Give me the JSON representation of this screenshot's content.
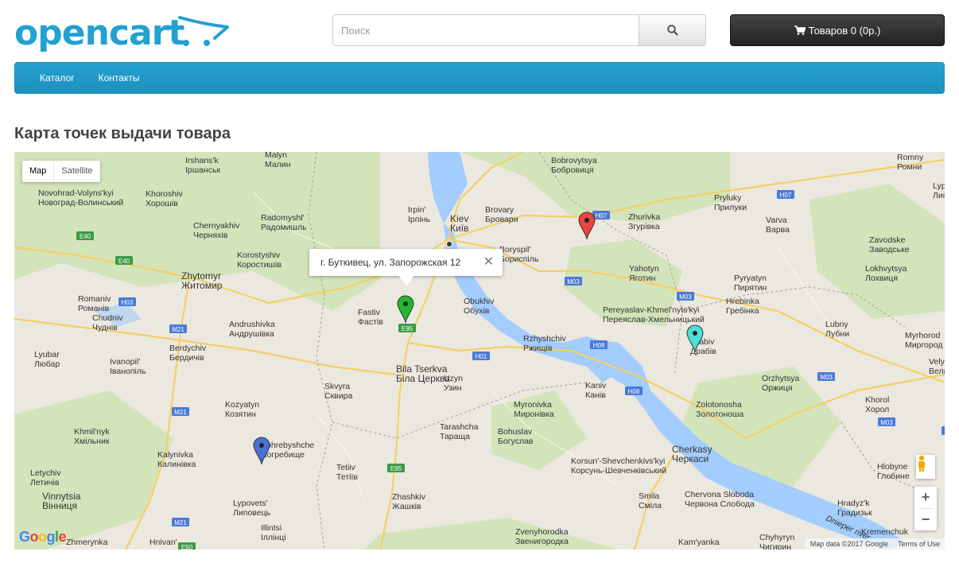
{
  "header": {
    "logo_text": "opencart",
    "search_placeholder": "Поиск",
    "cart_label": "Товаров 0 (0р.)"
  },
  "menu": {
    "items": [
      {
        "label": "Каталог"
      },
      {
        "label": "Контакты"
      }
    ]
  },
  "page": {
    "title": "Карта точек выдачи товара"
  },
  "map": {
    "type_buttons": [
      {
        "label": "Map"
      },
      {
        "label": "Satellite"
      }
    ],
    "infowindow_text": "г. Буткивец, ул. Запорожская 12",
    "brand": "Google",
    "attribution": [
      "Map data ©2017 Google",
      "Terms of Use"
    ],
    "markers": [
      {
        "color": "#e8453c"
      },
      {
        "color": "#1fb830"
      },
      {
        "color": "#4be0d6"
      },
      {
        "color": "#4b71d7"
      }
    ],
    "cities": [
      {
        "name": "Malyn",
        "local": "Малин"
      },
      {
        "name": "Irshans'k",
        "local": "Іршанськ"
      },
      {
        "name": "Bobrovytsya",
        "local": "Бобровиця"
      },
      {
        "name": "Romny",
        "local": "Ромни"
      },
      {
        "name": "Novohrad-Volyns'kyi",
        "local": "Новоград-Волинський"
      },
      {
        "name": "Khoroshiv",
        "local": "Хорошів"
      },
      {
        "name": "Radomyshl'",
        "local": "Радомишль"
      },
      {
        "name": "Irpin'",
        "local": "Ірпінь"
      },
      {
        "name": "Kiev",
        "local": "Київ"
      },
      {
        "name": "Brovary",
        "local": "Бровари"
      },
      {
        "name": "Zhurivka",
        "local": "Згурівка"
      },
      {
        "name": "Pryluky",
        "local": "Прилуки"
      },
      {
        "name": "Lypova Dolyna",
        "local": "Липова Долина"
      },
      {
        "name": "Chernyakhiv",
        "local": "Черняхів"
      },
      {
        "name": "Varva",
        "local": "Варва"
      },
      {
        "name": "Boryspil'",
        "local": "Бориспіль"
      },
      {
        "name": "Zavodske",
        "local": "Заводське"
      },
      {
        "name": "Korostyshiv",
        "local": "Коростишів"
      },
      {
        "name": "Zhytomyr",
        "local": "Житомир"
      },
      {
        "name": "Yahotyn",
        "local": "Яготин"
      },
      {
        "name": "Pyryatyn",
        "local": "Пирятин"
      },
      {
        "name": "Lokhvytsya",
        "local": "Лохвиця"
      },
      {
        "name": "Romaniv",
        "local": "Романів"
      },
      {
        "name": "Fastiv",
        "local": "Фастів"
      },
      {
        "name": "Obukhiv",
        "local": "Обухів"
      },
      {
        "name": "Pereyaslav-Khmel'nyts'kyi",
        "local": "Переяслав-Хмельницький"
      },
      {
        "name": "Hrebinka",
        "local": "Гребінка"
      },
      {
        "name": "Lubny",
        "local": "Лубни"
      },
      {
        "name": "Chudniv",
        "local": "Чуднів"
      },
      {
        "name": "Andrushivka",
        "local": "Андрушівка"
      },
      {
        "name": "Rzhyshchiv",
        "local": "Ржищів"
      },
      {
        "name": "Drabiv",
        "local": "Драбів"
      },
      {
        "name": "Myrhorod",
        "local": "Миргород"
      },
      {
        "name": "Berdychiv",
        "local": "Бердичів"
      },
      {
        "name": "Lyubar",
        "local": "Любар"
      },
      {
        "name": "Ivanopil'",
        "local": "Іванопіль"
      },
      {
        "name": "Bila Tserkva",
        "local": "Біла Церква"
      },
      {
        "name": "Uzyn",
        "local": "Узин"
      },
      {
        "name": "Kaniv",
        "local": "Канів"
      },
      {
        "name": "Orzhytsya",
        "local": "Оржиця"
      },
      {
        "name": "Velyka Bahachka",
        "local": "Велика Багачка"
      },
      {
        "name": "Skvyra",
        "local": "Сквира"
      },
      {
        "name": "Myronivka",
        "local": "Миронівка"
      },
      {
        "name": "Zolotonosha",
        "local": "Золотоноша"
      },
      {
        "name": "Khorol",
        "local": "Хорол"
      },
      {
        "name": "Kozyatyn",
        "local": "Козятин"
      },
      {
        "name": "Khmil'nyk",
        "local": "Хмільник"
      },
      {
        "name": "Tarashcha",
        "local": "Тараща"
      },
      {
        "name": "Bohuslav",
        "local": "Богуслав"
      },
      {
        "name": "Pohrebyshche",
        "local": "Погребище"
      },
      {
        "name": "Kalynivka",
        "local": "Калинівка"
      },
      {
        "name": "Korsun'-Shevchenkivs'kyi",
        "local": "Корсунь-Шевченківський"
      },
      {
        "name": "Cherkasy",
        "local": "Черкаси"
      },
      {
        "name": "Letychiv",
        "local": "Летичів"
      },
      {
        "name": "Tetiiv",
        "local": "Тетіїв"
      },
      {
        "name": "Hlobyne",
        "local": "Глобине"
      },
      {
        "name": "Vinnytsia",
        "local": "Вінниця"
      },
      {
        "name": "Lypovets'",
        "local": "Липовець"
      },
      {
        "name": "Zhashkiv",
        "local": "Жашків"
      },
      {
        "name": "Smila",
        "local": "Сміла"
      },
      {
        "name": "Chervona Sloboda",
        "local": "Червона Слобода"
      },
      {
        "name": "Hradyz'k",
        "local": "Градизьк"
      },
      {
        "name": "Illintsi",
        "local": "Іллінці"
      },
      {
        "name": "Zvenyhorodka",
        "local": "Звенигородка"
      },
      {
        "name": "Kremenchuk",
        "local": ""
      },
      {
        "name": "Zhmerynka",
        "local": ""
      },
      {
        "name": "Hnivan'",
        "local": ""
      },
      {
        "name": "Kam'yanka",
        "local": ""
      },
      {
        "name": "Chyhyryn",
        "local": "Чигирин"
      },
      {
        "name": "Dnieper river",
        "local": ""
      }
    ],
    "shields": [
      "E40",
      "E40",
      "H03",
      "M21",
      "E95",
      "H07",
      "H07",
      "M03",
      "M03",
      "H08",
      "H08",
      "H01",
      "M21",
      "E95",
      "M21",
      "E50",
      "M03",
      "M03",
      "H03"
    ]
  }
}
